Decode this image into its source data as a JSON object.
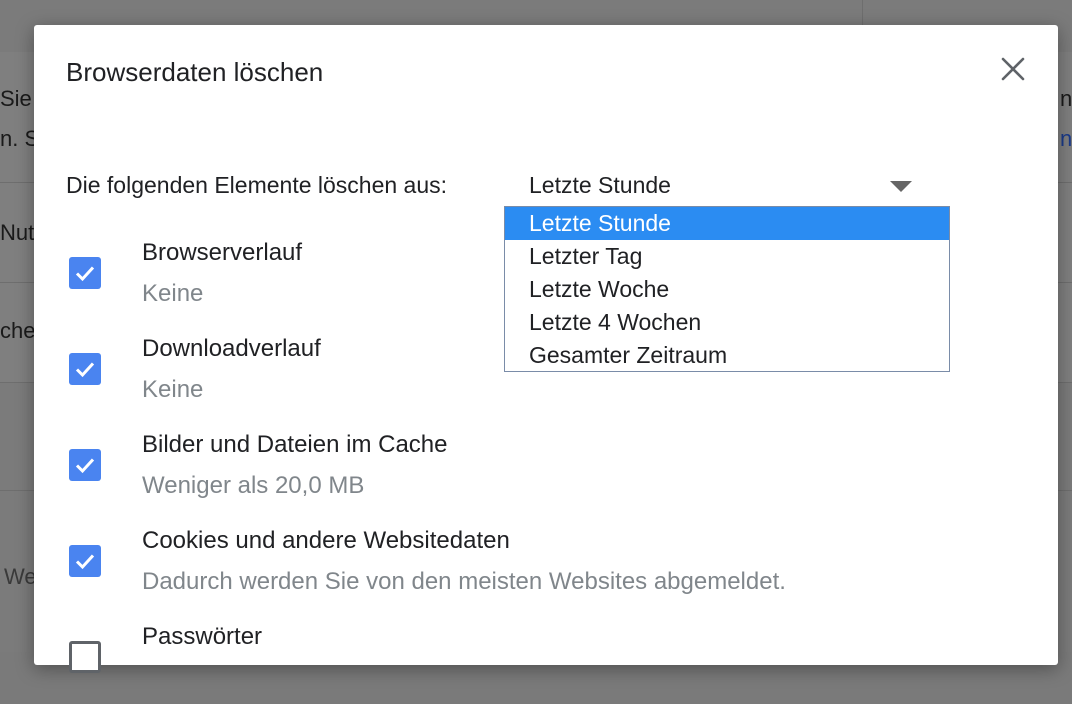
{
  "background": {
    "fragments": [
      "Sie",
      "n. S",
      "Nut",
      "che",
      "We"
    ],
    "right_fragments": [
      "n C",
      "n"
    ]
  },
  "dialog": {
    "title": "Browserdaten löschen",
    "close_icon": "close-icon"
  },
  "time_range": {
    "label": "Die folgenden Elemente löschen aus:",
    "selected": "Letzte Stunde",
    "options": [
      "Letzte Stunde",
      "Letzter Tag",
      "Letzte Woche",
      "Letzte 4 Wochen",
      "Gesamter Zeitraum"
    ]
  },
  "items": [
    {
      "title": "Browserverlauf",
      "subtitle": "Keine",
      "checked": true
    },
    {
      "title": "Downloadverlauf",
      "subtitle": "Keine",
      "checked": true
    },
    {
      "title": "Bilder und Dateien im Cache",
      "subtitle": "Weniger als 20,0 MB",
      "checked": true
    },
    {
      "title": "Cookies und andere Websitedaten",
      "subtitle": "Dadurch werden Sie von den meisten Websites abgemeldet.",
      "checked": true
    },
    {
      "title": "Passwörter",
      "subtitle": "",
      "checked": false
    }
  ],
  "colors": {
    "accent": "#4a84f0",
    "selected_option": "#2b8cf2"
  }
}
